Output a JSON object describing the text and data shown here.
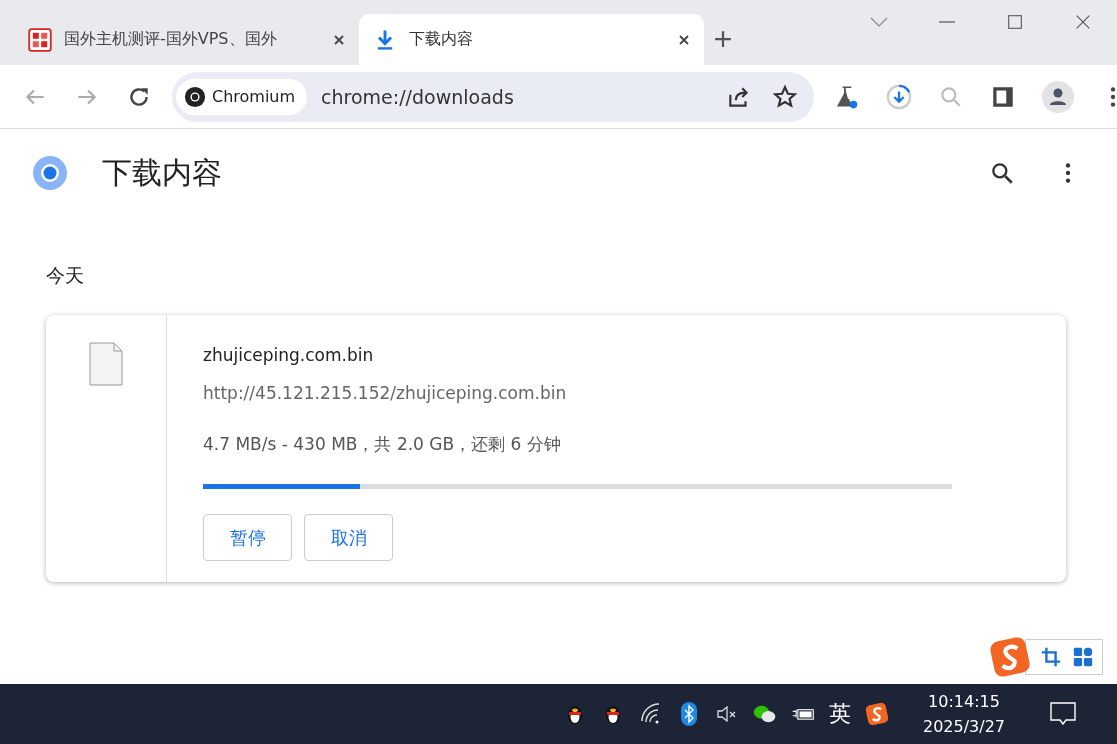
{
  "tabs": [
    {
      "title": "国外主机测评-国外VPS、国外",
      "selected": false,
      "kind": "site"
    },
    {
      "title": "下载内容",
      "selected": true,
      "kind": "download"
    }
  ],
  "toolbar": {
    "chip": "Chromium",
    "url": "chrome://downloads"
  },
  "page": {
    "title": "下载内容",
    "section": "今天",
    "download": {
      "filename": "zhujiceping.com.bin",
      "url": "http://45.121.215.152/zhujiceping.com.bin",
      "status": "4.7 MB/s - 430 MB，共 2.0 GB，还剩 6 分钟",
      "level": 0.21,
      "buttons": [
        "暂停",
        "取消"
      ]
    }
  },
  "taskbar": {
    "ime": "英",
    "time": "10:14:15",
    "date": "2025/3/27"
  }
}
